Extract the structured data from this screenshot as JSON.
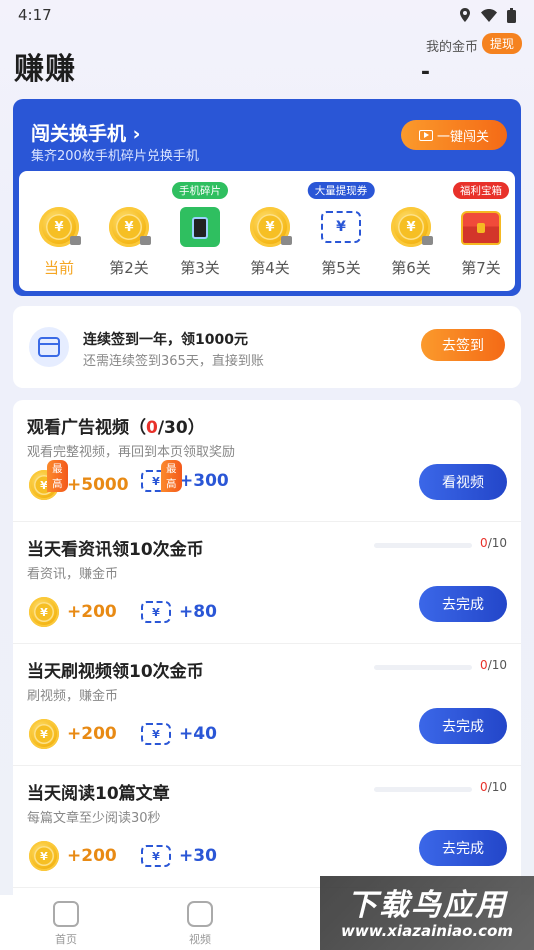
{
  "status_bar": {
    "time": "4:17"
  },
  "header": {
    "title": "赚赚",
    "coins_label": "我的金币",
    "withdraw_label": "提现",
    "coins_value": "-"
  },
  "challenge": {
    "title": "闯关换手机",
    "chevron": "›",
    "subtitle": "集齐200枚手机碎片兑换手机",
    "onekey_label": "一键闯关",
    "levels": [
      {
        "label": "当前",
        "icon": "coin-icon",
        "badge": "",
        "current": true
      },
      {
        "label": "第2关",
        "icon": "coin-icon",
        "badge": ""
      },
      {
        "label": "第3关",
        "icon": "phone-fragment-icon",
        "badge": "手机碎片",
        "badge_color": "#2fbf60"
      },
      {
        "label": "第4关",
        "icon": "coin-icon",
        "badge": ""
      },
      {
        "label": "第5关",
        "icon": "withdraw-coupon-icon",
        "badge": "大量提现券",
        "badge_color": "#2a56d6"
      },
      {
        "label": "第6关",
        "icon": "coin-icon",
        "badge": ""
      },
      {
        "label": "第7关",
        "icon": "treasure-chest-icon",
        "badge": "福利宝箱",
        "badge_color": "#e8312a"
      }
    ]
  },
  "signin": {
    "title": "连续签到一年，领1000元",
    "subtitle": "还需连续签到365天，直接到账",
    "button": "去签到"
  },
  "tasks": [
    {
      "title_main": "观看广告视频（",
      "title_count": "0",
      "title_tail": "/30）",
      "desc": "观看完整视频，再回到本页领取奖励",
      "coin_reward": "+5000",
      "coupon_reward": "+300",
      "tag": "最高",
      "button": "看视频",
      "progress": null
    },
    {
      "title_main": "当天看资讯领10次金币",
      "desc": "看资讯，赚金币",
      "coin_reward": "+200",
      "coupon_reward": "+80",
      "button": "去完成",
      "progress_done": "0",
      "progress_total": "/10"
    },
    {
      "title_main": "当天刷视频领10次金币",
      "desc": "刷视频，赚金币",
      "coin_reward": "+200",
      "coupon_reward": "+40",
      "button": "去完成",
      "progress_done": "0",
      "progress_total": "/10"
    },
    {
      "title_main": "当天阅读10篇文章",
      "desc": "每篇文章至少阅读30秒",
      "coin_reward": "+200",
      "coupon_reward": "+30",
      "button": "去完成",
      "progress_done": "0",
      "progress_total": "/10"
    }
  ],
  "tabbar": {
    "home": "首页",
    "video": "视频"
  },
  "watermark": {
    "line1": "下载鸟应用",
    "line2": "www.xiazainiao.com"
  },
  "colors": {
    "primary": "#2a56d6",
    "accent": "#f46a16",
    "gold": "#e88a14",
    "red": "#e8312a"
  }
}
